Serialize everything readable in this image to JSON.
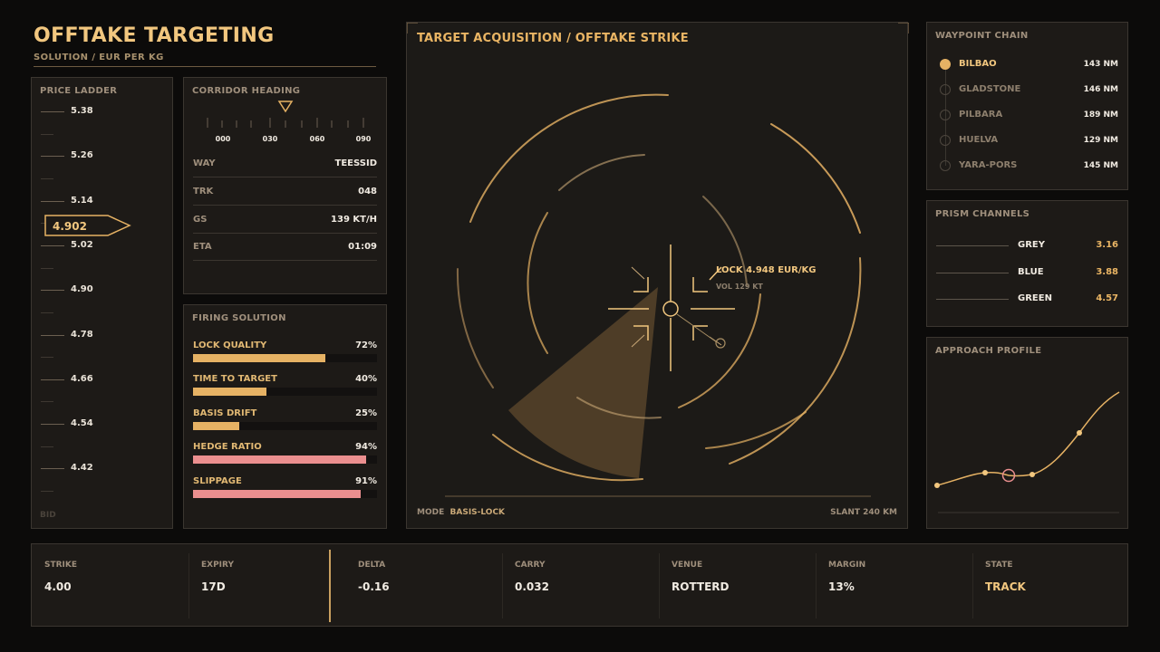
{
  "header": {
    "title": "OFFTAKE TARGETING",
    "subtitle": "SOLUTION / EUR PER KG"
  },
  "price_ladder": {
    "title": "PRICE LADDER",
    "levels": [
      "5.38",
      "5.26",
      "5.14",
      "5.02",
      "4.90",
      "4.78",
      "4.66",
      "4.54",
      "4.42"
    ],
    "current": "4.902",
    "footer": "BID"
  },
  "corridor": {
    "title": "CORRIDOR HEADING",
    "compass": [
      "000",
      "030",
      "060",
      "090"
    ],
    "rows": [
      {
        "key": "WAY",
        "value": "TEESSID"
      },
      {
        "key": "TRK",
        "value": "048"
      },
      {
        "key": "GS",
        "value": "139 KT/H"
      },
      {
        "key": "ETA",
        "value": "01:09"
      }
    ]
  },
  "firing": {
    "title": "FIRING SOLUTION",
    "items": [
      {
        "label": "LOCK QUALITY",
        "value": "72%",
        "level": 72,
        "color": "#e6b264"
      },
      {
        "label": "TIME TO TARGET",
        "value": "40%",
        "level": 40,
        "color": "#e6b264"
      },
      {
        "label": "BASIS DRIFT",
        "value": "25%",
        "level": 25,
        "color": "#e6b264"
      },
      {
        "label": "HEDGE RATIO",
        "value": "94%",
        "level": 94,
        "color": "#eb8f8f"
      },
      {
        "label": "SLIPPAGE",
        "value": "91%",
        "level": 91,
        "color": "#eb8f8f"
      }
    ]
  },
  "target": {
    "title": "TARGET ACQUISITION / OFFTAKE STRIKE",
    "lock": "LOCK 4.948 EUR/KG",
    "vol": "VOL 129 KT",
    "mode_label": "MODE",
    "mode_value": "BASIS-LOCK",
    "slant": "SLANT 240 KM"
  },
  "waypoints": {
    "title": "WAYPOINT CHAIN",
    "items": [
      {
        "name": "BILBAO",
        "dist": "143 NM",
        "active": true
      },
      {
        "name": "GLADSTONE",
        "dist": "146 NM",
        "active": false
      },
      {
        "name": "PILBARA",
        "dist": "189 NM",
        "active": false
      },
      {
        "name": "HUELVA",
        "dist": "129 NM",
        "active": false
      },
      {
        "name": "YARA-PORS",
        "dist": "145 NM",
        "active": false
      }
    ]
  },
  "prism": {
    "title": "PRISM CHANNELS",
    "items": [
      {
        "name": "GREY",
        "value": "3.16"
      },
      {
        "name": "BLUE",
        "value": "3.88"
      },
      {
        "name": "GREEN",
        "value": "4.57"
      }
    ]
  },
  "approach": {
    "title": "APPROACH PROFILE"
  },
  "strip": [
    {
      "key": "STRIKE",
      "value": "4.00",
      "color": "#f1ebe2"
    },
    {
      "key": "EXPIRY",
      "value": "17D",
      "color": "#f1ebe2"
    },
    {
      "key": "DELTA",
      "value": "-0.16",
      "color": "#f1ebe2"
    },
    {
      "key": "CARRY",
      "value": "0.032",
      "color": "#f1ebe2"
    },
    {
      "key": "VENUE",
      "value": "ROTTERD",
      "color": "#f1ebe2"
    },
    {
      "key": "MARGIN",
      "value": "13%",
      "color": "#f1ebe2"
    },
    {
      "key": "STATE",
      "value": "TRACK",
      "color": "#f2c77f"
    }
  ],
  "colors": {
    "accent": "#e6b264",
    "warn": "#eb8f8f",
    "panel": "#1d1a17",
    "background": "#0c0b0a"
  }
}
